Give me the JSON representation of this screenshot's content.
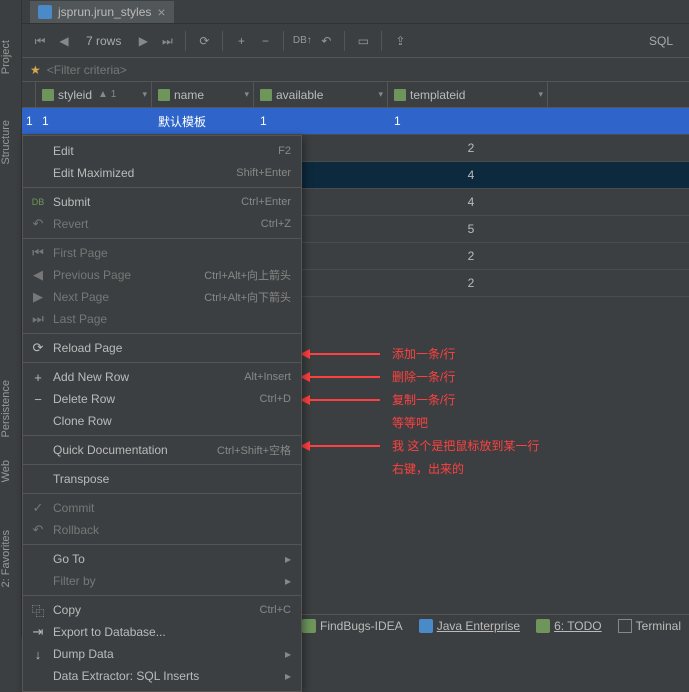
{
  "tab": {
    "title": "jsprun.jrun_styles"
  },
  "toolbar": {
    "rows": "7 rows",
    "sql": "SQL"
  },
  "filter": {
    "placeholder": "<Filter criteria>"
  },
  "columns": {
    "c0": "styleid",
    "c0_sort": "▲ 1",
    "c1": "name",
    "c2": "available",
    "c3": "templateid"
  },
  "rows": [
    {
      "n": "1",
      "c0": "1",
      "c1": "默认模板",
      "c2": "1",
      "c3": "1"
    },
    {
      "n": "",
      "c0": "",
      "c1": "",
      "c2": "",
      "c3": "2"
    },
    {
      "n": "",
      "c0": "",
      "c1": "",
      "c2": "",
      "c3": "4"
    },
    {
      "n": "",
      "c0": "",
      "c1": "",
      "c2": "",
      "c3": "4"
    },
    {
      "n": "",
      "c0": "",
      "c1": "",
      "c2": "",
      "c3": "5"
    },
    {
      "n": "",
      "c0": "",
      "c1": "",
      "c2": "",
      "c3": "2"
    },
    {
      "n": "",
      "c0": "",
      "c1": "",
      "c2": "",
      "c3": "2"
    }
  ],
  "menu": {
    "edit": "Edit",
    "edit_sc": "F2",
    "edit_max": "Edit Maximized",
    "edit_max_sc": "Shift+Enter",
    "submit": "Submit",
    "submit_sc": "Ctrl+Enter",
    "revert": "Revert",
    "revert_sc": "Ctrl+Z",
    "first": "First Page",
    "prev": "Previous Page",
    "prev_sc": "Ctrl+Alt+向上箭头",
    "next": "Next Page",
    "next_sc": "Ctrl+Alt+向下箭头",
    "last": "Last Page",
    "reload": "Reload Page",
    "add": "Add New Row",
    "add_sc": "Alt+Insert",
    "delete": "Delete Row",
    "delete_sc": "Ctrl+D",
    "clone": "Clone Row",
    "quickdoc": "Quick Documentation",
    "quickdoc_sc": "Ctrl+Shift+空格",
    "transpose": "Transpose",
    "commit": "Commit",
    "rollback": "Rollback",
    "goto": "Go To",
    "filterby": "Filter by",
    "copy": "Copy",
    "copy_sc": "Ctrl+C",
    "export": "Export to Database...",
    "dump": "Dump Data",
    "extractor": "Data Extractor: SQL Inserts"
  },
  "annotations": {
    "a1": "添加一条/行",
    "a2": "删除一条/行",
    "a3": "复制一条/行",
    "a4": "等等吧",
    "a5": "我 这个是把鼠标放到某一行",
    "a6": "右键，出来的"
  },
  "bottom": {
    "findbugs": "FindBugs-IDEA",
    "javaee": "Java Enterprise",
    "todo": "6: TODO",
    "terminal": "Terminal"
  },
  "side": {
    "persistence": "Persistence",
    "web": "Web",
    "favorites": "2: Favorites",
    "structure": "Structure",
    "project": "Project"
  }
}
